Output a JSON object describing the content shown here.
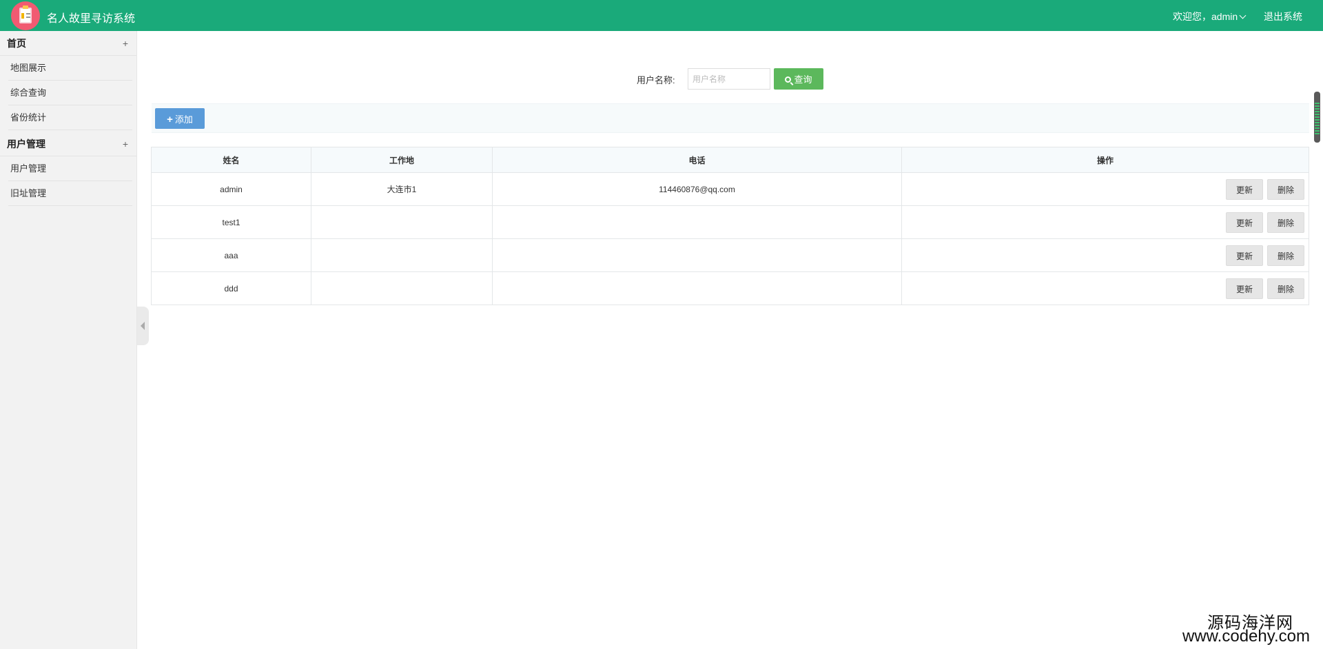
{
  "header": {
    "app_title": "名人故里寻访系统",
    "welcome": "欢迎您，admin",
    "logout": "退出系统",
    "icons": {
      "logo": "clipboard-logo-icon",
      "user_menu": "chevron-down-icon"
    }
  },
  "sidebar": {
    "groups": [
      {
        "title": "首页",
        "toggle": "+",
        "items": [
          "地图展示",
          "综合查询",
          "省份统计"
        ]
      },
      {
        "title": "用户管理",
        "toggle": "+",
        "items": [
          "用户管理",
          "旧址管理"
        ]
      }
    ]
  },
  "search": {
    "label": "用户名称:",
    "placeholder": "用户名称",
    "value": "",
    "button": "查询",
    "icon": "search-icon"
  },
  "toolbar": {
    "add_label": "添加",
    "add_icon": "plus-icon"
  },
  "table": {
    "headers": [
      "姓名",
      "工作地",
      "电话",
      "操作"
    ],
    "rows": [
      {
        "name": "admin",
        "workplace": "大连市1",
        "phone": "114460876@qq.com"
      },
      {
        "name": "test1",
        "workplace": "",
        "phone": ""
      },
      {
        "name": "aaa",
        "workplace": "",
        "phone": ""
      },
      {
        "name": "ddd",
        "workplace": "",
        "phone": ""
      }
    ],
    "actions": {
      "update": "更新",
      "delete": "删除"
    }
  },
  "watermark": {
    "line1": "源码海洋网",
    "line2": "www.codehy.com"
  },
  "colors": {
    "header_bg": "#1aaa7a",
    "search_button": "#5cb85c",
    "add_button": "#5a9bd9"
  }
}
